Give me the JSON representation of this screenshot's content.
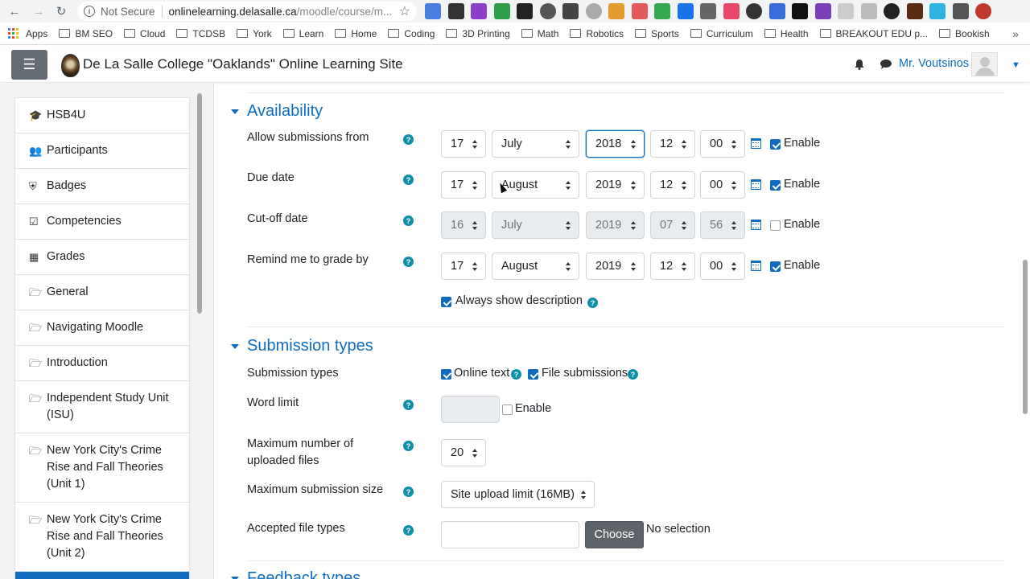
{
  "browser": {
    "security": "Not Secure",
    "url_host": "onlinelearning.delasalle.ca",
    "url_path": "/moodle/course/m..."
  },
  "bookmarks": [
    "Apps",
    "BM SEO",
    "Cloud",
    "TCDSB",
    "York",
    "Learn",
    "Home",
    "Coding",
    "3D Printing",
    "Math",
    "Robotics",
    "Sports",
    "Curriculum",
    "Health",
    "BREAKOUT EDU p...",
    "Bookish"
  ],
  "navbar": {
    "site_name": "De La Salle College \"Oaklands\" Online Learning Site",
    "user_name": "Mr. Voutsinos"
  },
  "drawer": {
    "items": [
      {
        "label": "HSB4U",
        "icon": "graduation-cap-icon"
      },
      {
        "label": "Participants",
        "icon": "users-icon"
      },
      {
        "label": "Badges",
        "icon": "shield-icon"
      },
      {
        "label": "Competencies",
        "icon": "checkbox-icon"
      },
      {
        "label": "Grades",
        "icon": "table-icon"
      },
      {
        "label": "General",
        "icon": "folder-icon"
      },
      {
        "label": "Navigating Moodle",
        "icon": "folder-icon"
      },
      {
        "label": "Introduction",
        "icon": "folder-icon"
      },
      {
        "label": "Independent Study Unit (ISU)",
        "icon": "folder-icon"
      },
      {
        "label": "New York City's Crime Rise and Fall Theories (Unit 1)",
        "icon": "folder-icon"
      },
      {
        "label": "New York City's Crime Rise and Fall Theories (Unit 2)",
        "icon": "folder-icon"
      }
    ]
  },
  "availability": {
    "title": "Availability",
    "enable_label": "Enable",
    "rows": [
      {
        "label": "Allow submissions from",
        "day": "17",
        "month": "July",
        "year": "2018",
        "hour": "12",
        "minute": "00",
        "enabled": true
      },
      {
        "label": "Due date",
        "day": "17",
        "month": "August",
        "year": "2019",
        "hour": "12",
        "minute": "00",
        "enabled": true
      },
      {
        "label": "Cut-off date",
        "day": "16",
        "month": "July",
        "year": "2019",
        "hour": "07",
        "minute": "56",
        "enabled": false
      },
      {
        "label": "Remind me to grade by",
        "day": "17",
        "month": "August",
        "year": "2019",
        "hour": "12",
        "minute": "00",
        "enabled": true
      }
    ],
    "always_show_description": "Always show description"
  },
  "submission_types": {
    "title": "Submission types",
    "types_label": "Submission types",
    "online_text": "Online text",
    "file_submissions": "File submissions",
    "word_limit_label": "Word limit",
    "word_limit_enable": "Enable",
    "max_files_label": "Maximum number of uploaded files",
    "max_files_value": "20",
    "max_size_label": "Maximum submission size",
    "max_size_value": "Site upload limit (16MB)",
    "file_types_label": "Accepted file types",
    "choose_button": "Choose",
    "no_selection": "No selection"
  },
  "next_section_peek": "Feedback types"
}
